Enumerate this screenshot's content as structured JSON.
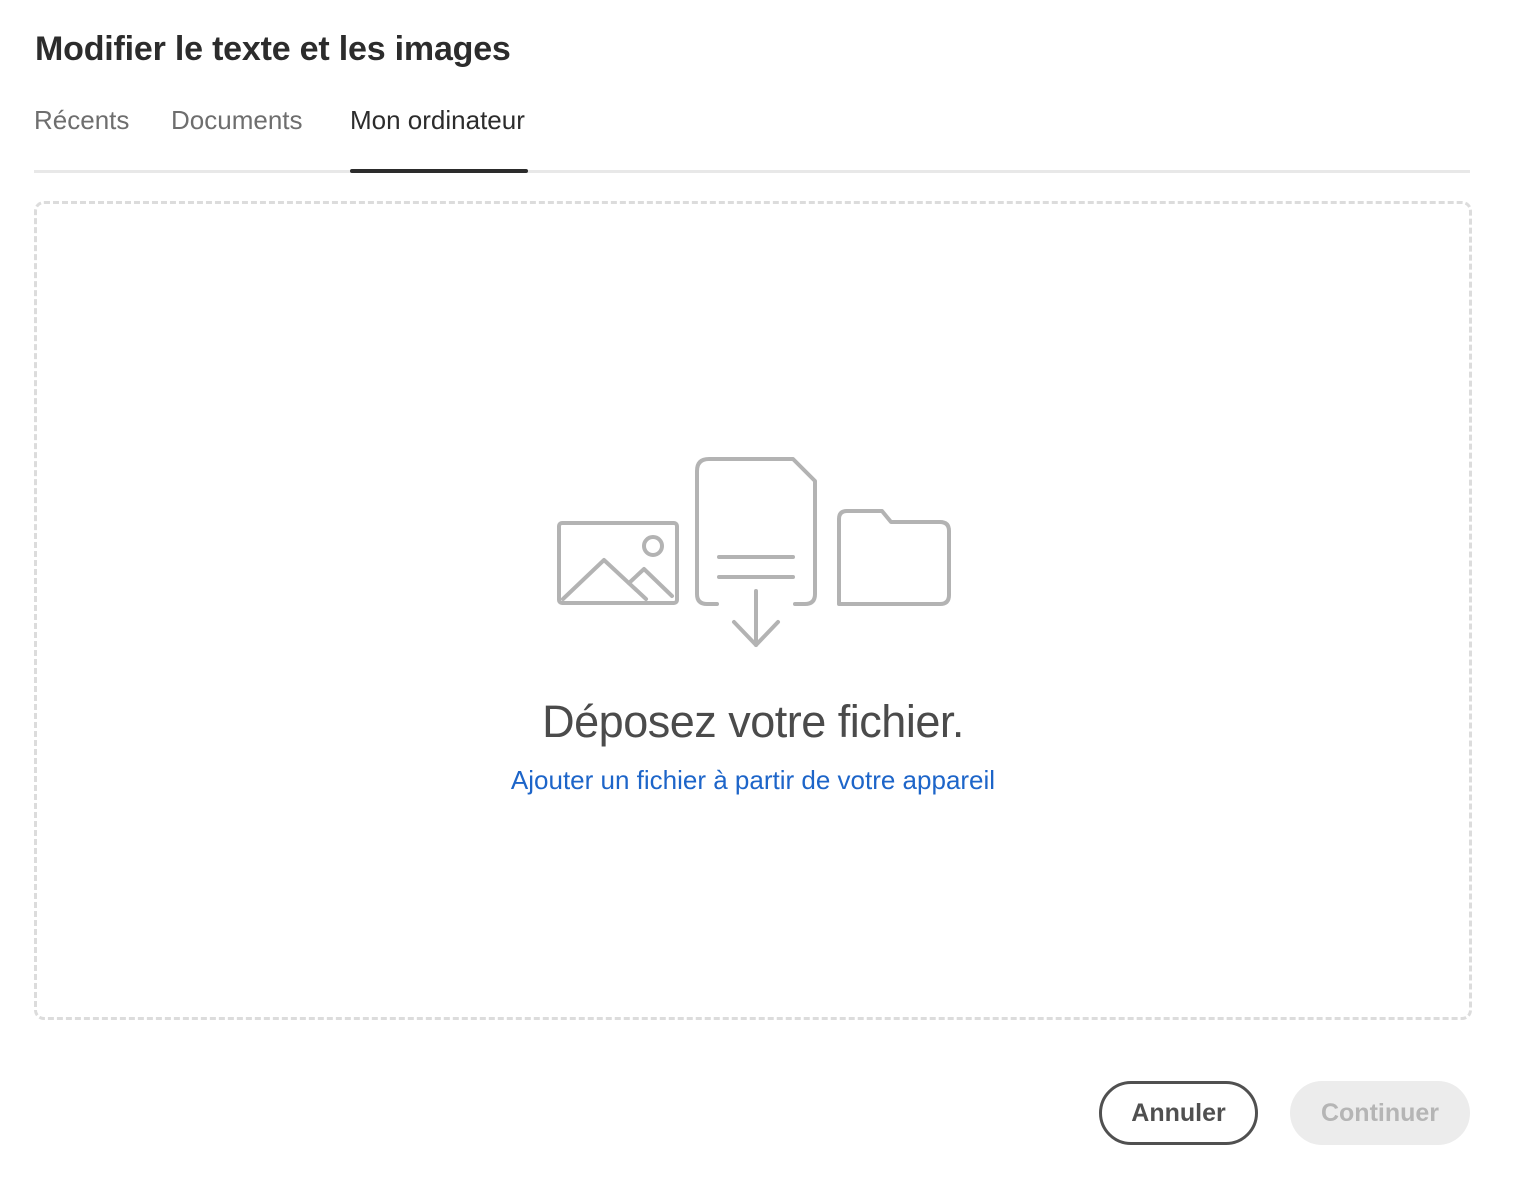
{
  "dialog": {
    "title": "Modifier le texte et les images"
  },
  "tabs": [
    {
      "label": "Récents",
      "active": false
    },
    {
      "label": "Documents",
      "active": false
    },
    {
      "label": "Mon ordinateur",
      "active": true
    }
  ],
  "dropzone": {
    "title": "Déposez votre fichier.",
    "link": "Ajouter un fichier à partir de votre appareil",
    "icons": [
      "image-icon",
      "document-download-icon",
      "folder-icon"
    ]
  },
  "footer": {
    "cancel_label": "Annuler",
    "continue_label": "Continuer",
    "continue_enabled": false
  },
  "colors": {
    "link": "#1d65c9",
    "icon_gray": "#b3b3b3",
    "text_dark": "#2c2c2c",
    "tab_inactive": "#6e6e6e"
  }
}
